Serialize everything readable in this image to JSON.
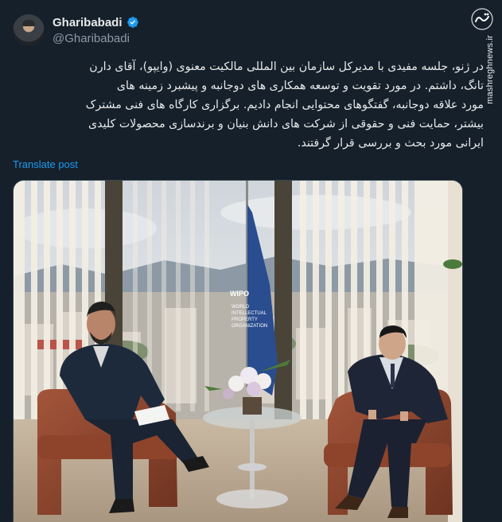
{
  "post": {
    "author": {
      "display_name": "Gharibabadi",
      "handle": "@Gharibabadi",
      "verified": true
    },
    "text_lines": [
      "در ژنو، جلسه مفیدی با مدیرکل سازمان بین المللی مالکیت معنوی (وایپو)، آقای دارن",
      "تانگ، داشتم.  در مورد تقویت و توسعه همکاری های دوجانبه و پیشبرد زمینه های",
      "مورد علاقه دوجانبه، گفتگوهای محتوایی انجام دادیم. برگزاری کارگاه های فنی مشترک",
      "بیشتر، حمایت فنی و حقوقی از شرکت های دانش بنیان و برندسازی محصولات کلیدی",
      "ایرانی مورد بحث و بررسی قرار گرفتند."
    ],
    "translate_label": "Translate post",
    "photo": {
      "flag_lines": [
        "WIPO",
        "WORLD",
        "INTELLECTUAL",
        "PROPERTY",
        "ORGANIZATION"
      ]
    }
  },
  "watermark": {
    "logo_text": "مشرق",
    "site": "mashreghnews.ir"
  },
  "colors": {
    "background": "#15202b",
    "text": "#e7e9ea",
    "secondary": "#8b98a5",
    "link": "#1d9bf0",
    "verified": "#1d9bf0",
    "flag": "#2a4d8f"
  }
}
